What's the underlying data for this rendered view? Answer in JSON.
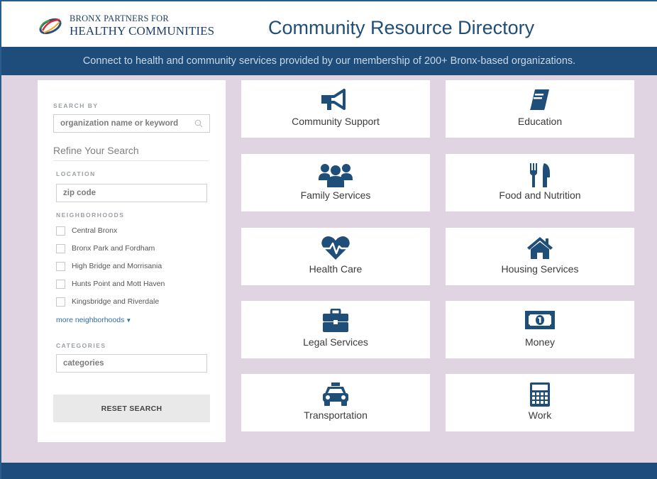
{
  "header": {
    "logo_line1": "BRONX PARTNERS FOR",
    "logo_line2": "HEALTHY COMMUNITIES",
    "title": "Community Resource Directory"
  },
  "banner": {
    "text": "Connect to health and community services provided by our membership of 200+ Bronx-based organizations."
  },
  "sidebar": {
    "search_by_label": "SEARCH BY",
    "search_placeholder": "organization name or keyword",
    "refine_heading": "Refine Your Search",
    "location_label": "LOCATION",
    "zip_placeholder": "zip code",
    "neighborhoods_label": "NEIGHBORHOODS",
    "neighborhoods": [
      "Central Bronx",
      "Bronx Park and Fordham",
      "High Bridge and Morrisania",
      "Hunts Point and Mott Haven",
      "Kingsbridge and Riverdale"
    ],
    "more_neighborhoods": "more neighborhoods",
    "categories_label": "CATEGORIES",
    "categories_placeholder": "categories",
    "reset_label": "RESET SEARCH"
  },
  "categories": [
    {
      "label": "Community Support",
      "icon": "megaphone-icon"
    },
    {
      "label": "Education",
      "icon": "book-icon"
    },
    {
      "label": "Family Services",
      "icon": "users-icon"
    },
    {
      "label": "Food and Nutrition",
      "icon": "utensils-icon"
    },
    {
      "label": "Health Care",
      "icon": "heartbeat-icon"
    },
    {
      "label": "Housing Services",
      "icon": "home-icon"
    },
    {
      "label": "Legal Services",
      "icon": "briefcase-icon"
    },
    {
      "label": "Money",
      "icon": "money-bill-icon"
    },
    {
      "label": "Transportation",
      "icon": "taxi-icon"
    },
    {
      "label": "Work",
      "icon": "calculator-icon"
    }
  ],
  "colors": {
    "brand_blue": "#1e4d7b",
    "icon_blue": "#1f4e79",
    "background_lavender": "#e0d4e3",
    "link_blue": "#2f6da8"
  }
}
